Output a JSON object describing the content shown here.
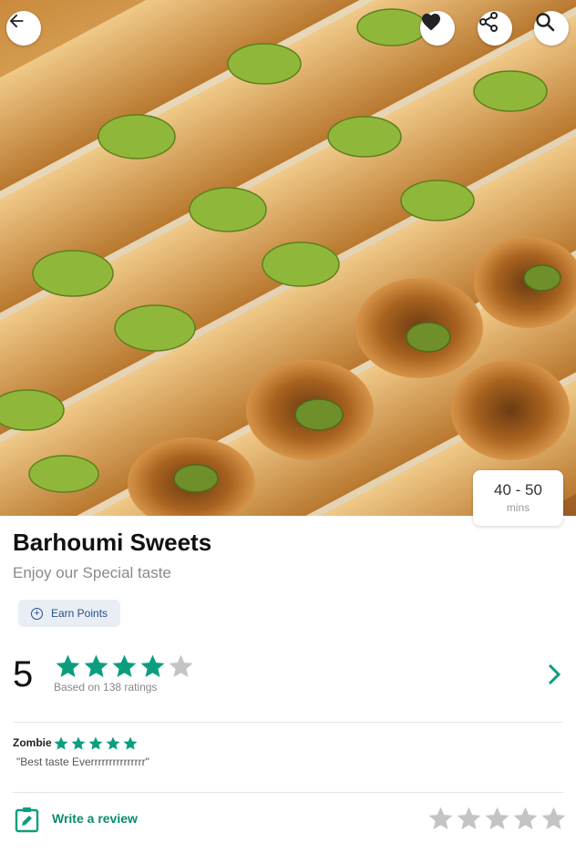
{
  "restaurant": {
    "name": "Barhoumi Sweets",
    "tagline": "Enjoy our Special taste"
  },
  "delivery": {
    "time": "40 - 50",
    "unit": "mins"
  },
  "earn_points": {
    "label": "Earn Points"
  },
  "rating": {
    "score": "5",
    "stars_filled": 4,
    "stars_total": 5,
    "based_on": "Based on 138 ratings"
  },
  "latest_review": {
    "author": "Zombie",
    "stars": 5,
    "text": "\"Best taste Everrrrrrrrrrrrrrr\""
  },
  "write_review": {
    "label": "Write a review",
    "stars_total": 5
  },
  "colors": {
    "accent": "#0a9e7e",
    "star_empty": "#c4c4c4",
    "link": "#2a4f8a"
  },
  "icons": [
    "back-arrow-icon",
    "heart-icon",
    "share-icon",
    "search-icon",
    "plus-circle-icon",
    "star-icon",
    "chevron-right-icon",
    "edit-clipboard-icon"
  ]
}
